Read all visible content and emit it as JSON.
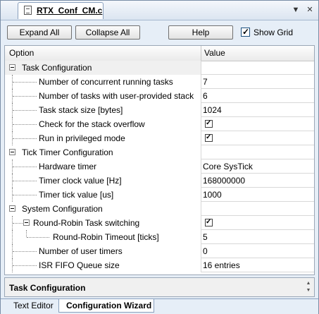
{
  "window": {
    "tab_title": "RTX_Conf_CM.c",
    "controls": {
      "dropdown": "▼",
      "pin": "✕",
      "close": "✕"
    }
  },
  "toolbar": {
    "expand_all": "Expand All",
    "collapse_all": "Collapse All",
    "help": "Help",
    "show_grid": "Show Grid",
    "show_grid_checked": true
  },
  "grid": {
    "col_option": "Option",
    "col_value": "Value",
    "rows": [
      {
        "label": "Task Configuration",
        "value": "",
        "level": 0,
        "group": true,
        "selected": true
      },
      {
        "label": "Number of concurrent running tasks",
        "value": "7",
        "level": 1
      },
      {
        "label": "Number of tasks with user-provided stack",
        "value": "6",
        "level": 1
      },
      {
        "label": "Task stack size [bytes]",
        "value": "1024",
        "level": 1
      },
      {
        "label": "Check for the stack overflow",
        "value": "",
        "checked": true,
        "level": 1
      },
      {
        "label": "Run in privileged mode",
        "value": "",
        "checked": true,
        "level": 1
      },
      {
        "label": "Tick Timer Configuration",
        "value": "",
        "level": 0,
        "group": true
      },
      {
        "label": "Hardware timer",
        "value": "Core SysTick",
        "level": 1
      },
      {
        "label": "Timer clock value [Hz]",
        "value": "168000000",
        "level": 1
      },
      {
        "label": "Timer tick value [us]",
        "value": "1000",
        "level": 1
      },
      {
        "label": "System Configuration",
        "value": "",
        "level": 0,
        "group": true
      },
      {
        "label": "Round-Robin Task switching",
        "value": "",
        "checked": true,
        "level": 1,
        "subgroup": true
      },
      {
        "label": "Round-Robin Timeout [ticks]",
        "value": "5",
        "level": 2
      },
      {
        "label": "Number of user timers",
        "value": "0",
        "level": 1
      },
      {
        "label": "ISR FIFO Queue size",
        "value": "16 entries",
        "level": 1
      }
    ]
  },
  "description": {
    "title": "Task Configuration"
  },
  "bottom_tabs": [
    {
      "label": "Text Editor",
      "active": false
    },
    {
      "label": "Configuration Wizard",
      "active": true
    }
  ]
}
